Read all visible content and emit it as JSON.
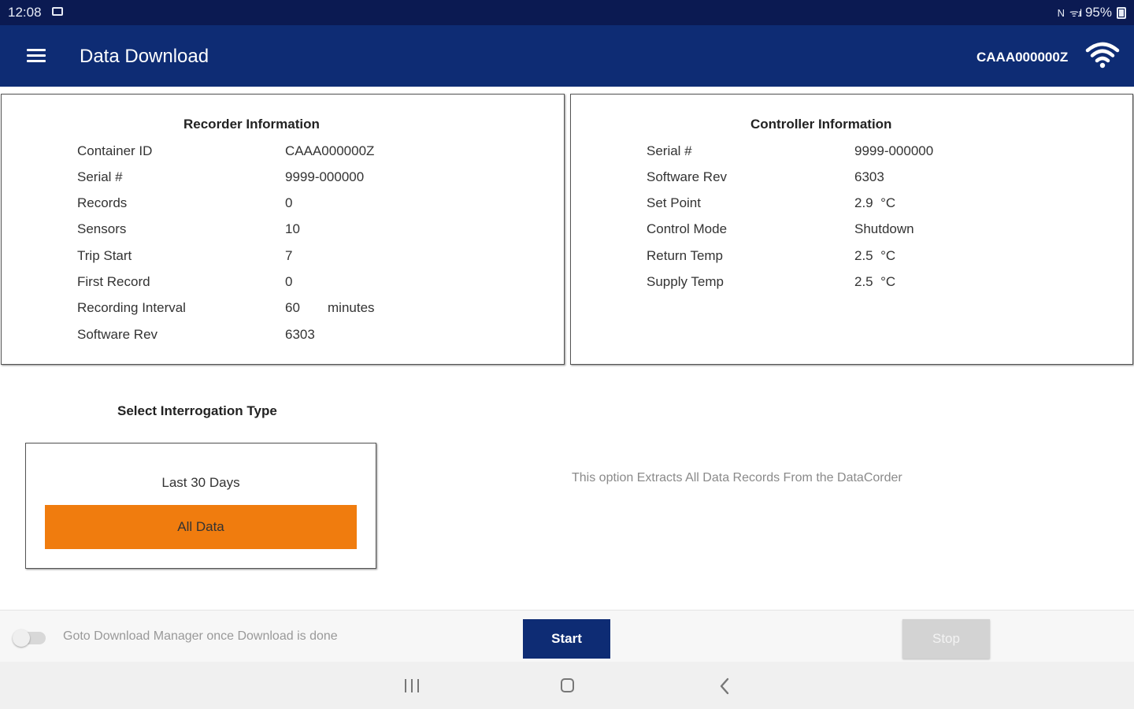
{
  "status_bar": {
    "time": "12:08",
    "mute_icon": "N",
    "signal": "ᯤ.ıl",
    "battery": "95%"
  },
  "app_bar": {
    "title": "Data Download",
    "device_id": "CAAA000000Z"
  },
  "recorder": {
    "title": "Recorder Information",
    "rows": [
      {
        "label": "Container ID",
        "value": "CAAA000000Z"
      },
      {
        "label": "Serial #",
        "value": "9999-000000"
      },
      {
        "label": "Records",
        "value": "0"
      },
      {
        "label": "Sensors",
        "value": "10"
      },
      {
        "label": "Trip Start",
        "value": "7"
      },
      {
        "label": "First Record",
        "value": "0"
      },
      {
        "label": "Recording Interval",
        "value": "60",
        "unit": "minutes"
      },
      {
        "label": "Software Rev",
        "value": "6303"
      }
    ]
  },
  "controller": {
    "title": "Controller Information",
    "rows": [
      {
        "label": "Serial #",
        "value": "9999-000000"
      },
      {
        "label": "Software Rev",
        "value": "6303"
      },
      {
        "label": "Set Point",
        "value": "2.9  °C"
      },
      {
        "label": "Control Mode",
        "value": "Shutdown"
      },
      {
        "label": "Return Temp",
        "value": "2.5  °C"
      },
      {
        "label": "Supply Temp",
        "value": "2.5  °C"
      }
    ]
  },
  "interrogation": {
    "title": "Select Interrogation Type",
    "option_last30": "Last 30 Days",
    "option_all": "All Data",
    "selected": "All Data",
    "description": "This option Extracts All Data Records From the DataCorder"
  },
  "footer": {
    "toggle_label": "Goto Download Manager once Download is done",
    "toggle_on": false,
    "start_label": "Start",
    "stop_label": "Stop"
  },
  "colors": {
    "status_bar": "#0b1a52",
    "app_bar": "#0e2c74",
    "accent_orange": "#f07c0e",
    "start_button": "#0e2c74",
    "stop_button_disabled": "#d3d3d3"
  },
  "icons": {
    "menu": "menu-icon",
    "wifi": "wifi-icon",
    "nav_recents": "recents-icon",
    "nav_home": "home-icon",
    "nav_back": "back-icon"
  }
}
